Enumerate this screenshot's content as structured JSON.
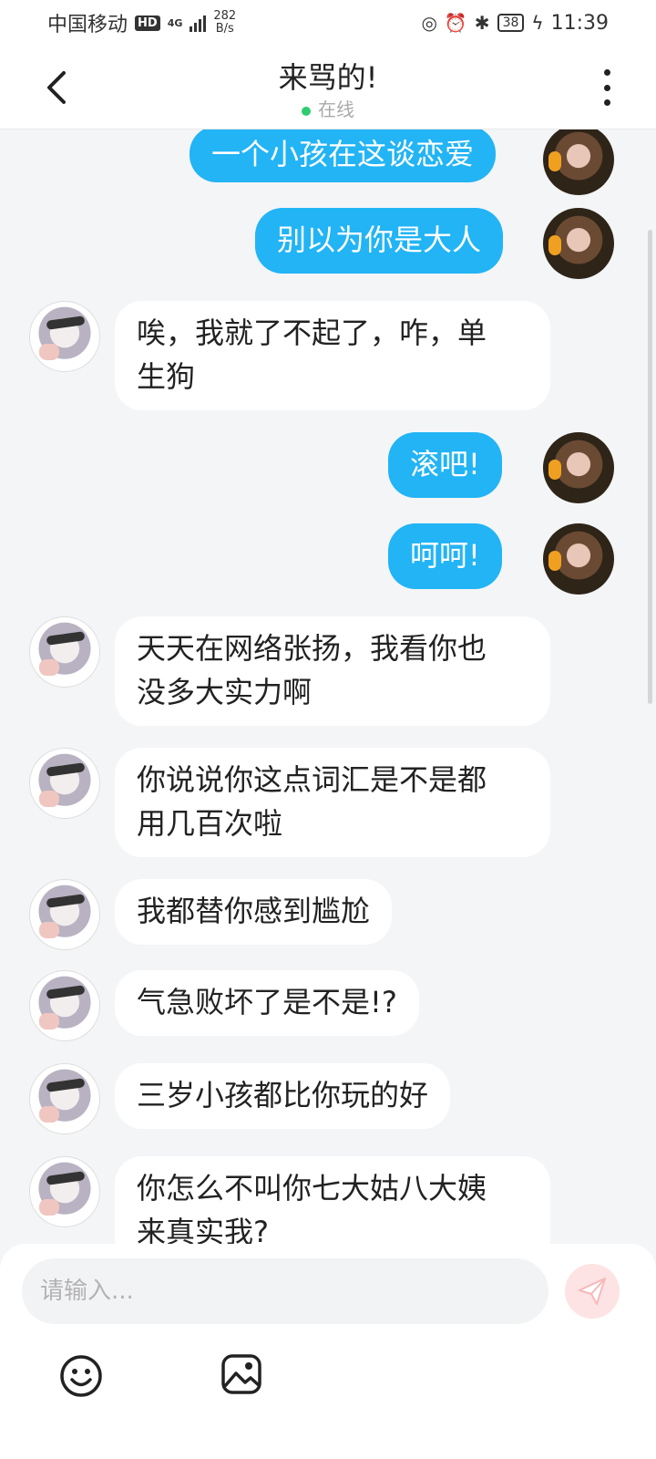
{
  "status_bar": {
    "carrier": "中国移动",
    "hd": "HD",
    "network": "4G",
    "speed_value": "282",
    "speed_unit": "B/s",
    "battery": "38",
    "time": "11:39"
  },
  "header": {
    "title": "来骂的!",
    "status": "在线"
  },
  "messages": [
    {
      "side": "me",
      "text": "一个小孩在这谈恋爱"
    },
    {
      "side": "me",
      "text": "别以为你是大人"
    },
    {
      "side": "them",
      "text": "唉，我就了不起了，咋，单\n生狗"
    },
    {
      "side": "me",
      "text": "滚吧!"
    },
    {
      "side": "me",
      "text": "呵呵!"
    },
    {
      "side": "them",
      "text": "天天在网络张扬，我看你也\n没多大实力啊"
    },
    {
      "side": "them",
      "text": "你说说你这点词汇是不是都\n用几百次啦"
    },
    {
      "side": "them",
      "text": "我都替你感到尴尬"
    },
    {
      "side": "them",
      "text": "气急败坏了是不是!?"
    },
    {
      "side": "them",
      "text": "三岁小孩都比你玩的好"
    },
    {
      "side": "them",
      "text": "你怎么不叫你七大姑八大姨\n来真实我?"
    }
  ],
  "composer": {
    "placeholder": "请输入..."
  },
  "colors": {
    "accent": "#22b4f5",
    "online": "#2ecc71",
    "background": "#f4f5f7",
    "send_bg": "#fde3e3"
  },
  "icons": [
    "back-icon",
    "more-icon",
    "send-icon",
    "emoji-icon",
    "image-icon"
  ]
}
